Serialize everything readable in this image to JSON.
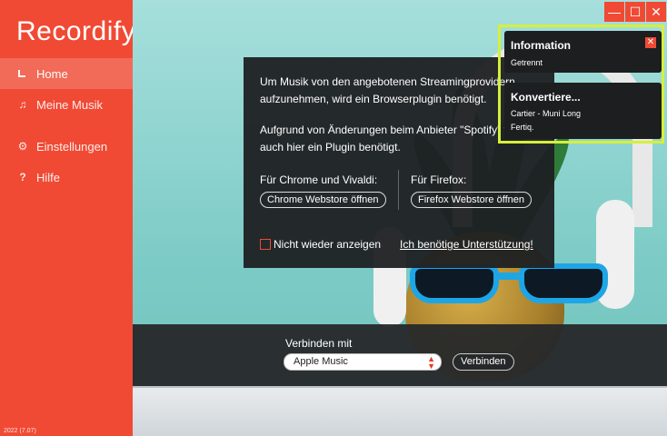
{
  "app": {
    "logo_text": "Recordify",
    "version": "2022 (7.07)"
  },
  "sidebar": {
    "items": [
      {
        "label": "Home",
        "icon": "home-icon",
        "active": true
      },
      {
        "label": "Meine Musik",
        "icon": "music-note-icon",
        "active": false
      },
      {
        "label": "Einstellungen",
        "icon": "gear-icon",
        "active": false
      },
      {
        "label": "Hilfe",
        "icon": "question-icon",
        "active": false
      }
    ]
  },
  "dialog": {
    "paragraph1": "Um Musik von den angebotenen Streamingprovidern aufzunehmen, wird ein Browserplugin benötigt.",
    "paragraph2": "Aufgrund von Änderungen beim Anbieter \"Spotify\" wird nun auch hier ein Plugin benötigt.",
    "chrome_label": "Für Chrome und Vivaldi:",
    "chrome_button": "Chrome Webstore öffnen",
    "firefox_label": "Für Firefox:",
    "firefox_button": "Firefox Webstore öffnen",
    "checkbox_label": "Nicht wieder anzeigen",
    "support_link": "Ich benötige Unterstützung!"
  },
  "connect": {
    "label": "Verbinden mit",
    "selected": "Apple Music",
    "button": "Verbinden"
  },
  "window": {
    "min": "—",
    "max": "☐",
    "close": "✕"
  },
  "notifications": [
    {
      "title": "Information",
      "lines": [
        "Getrennt"
      ]
    },
    {
      "title": "Konvertiere...",
      "lines": [
        "Cartier - Muni Long",
        "Fertiq."
      ]
    }
  ],
  "colors": {
    "accent": "#f04a34",
    "highlight": "#d7ef3a",
    "dark": "#1e2022"
  }
}
